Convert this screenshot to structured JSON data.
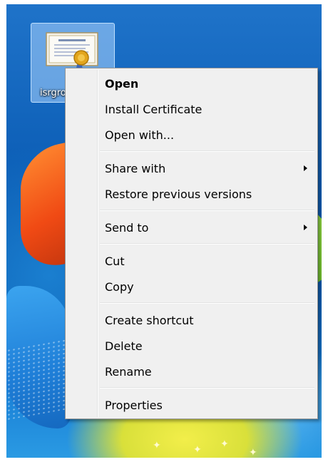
{
  "desktop": {
    "icon": {
      "label": "isrgro",
      "icon_name": "certificate-file-icon"
    }
  },
  "context_menu": {
    "groups": [
      [
        {
          "label": "Open",
          "bold": true,
          "submenu": false
        },
        {
          "label": "Install Certificate",
          "bold": false,
          "submenu": false
        },
        {
          "label": "Open with...",
          "bold": false,
          "submenu": false
        }
      ],
      [
        {
          "label": "Share with",
          "bold": false,
          "submenu": true
        },
        {
          "label": "Restore previous versions",
          "bold": false,
          "submenu": false
        }
      ],
      [
        {
          "label": "Send to",
          "bold": false,
          "submenu": true
        }
      ],
      [
        {
          "label": "Cut",
          "bold": false,
          "submenu": false
        },
        {
          "label": "Copy",
          "bold": false,
          "submenu": false
        }
      ],
      [
        {
          "label": "Create shortcut",
          "bold": false,
          "submenu": false
        },
        {
          "label": "Delete",
          "bold": false,
          "submenu": false
        },
        {
          "label": "Rename",
          "bold": false,
          "submenu": false
        }
      ],
      [
        {
          "label": "Properties",
          "bold": false,
          "submenu": false
        }
      ]
    ]
  },
  "colors": {
    "menu_background": "#f0f0f0",
    "menu_border": "#979797",
    "icon_selection": "#add6ff"
  }
}
